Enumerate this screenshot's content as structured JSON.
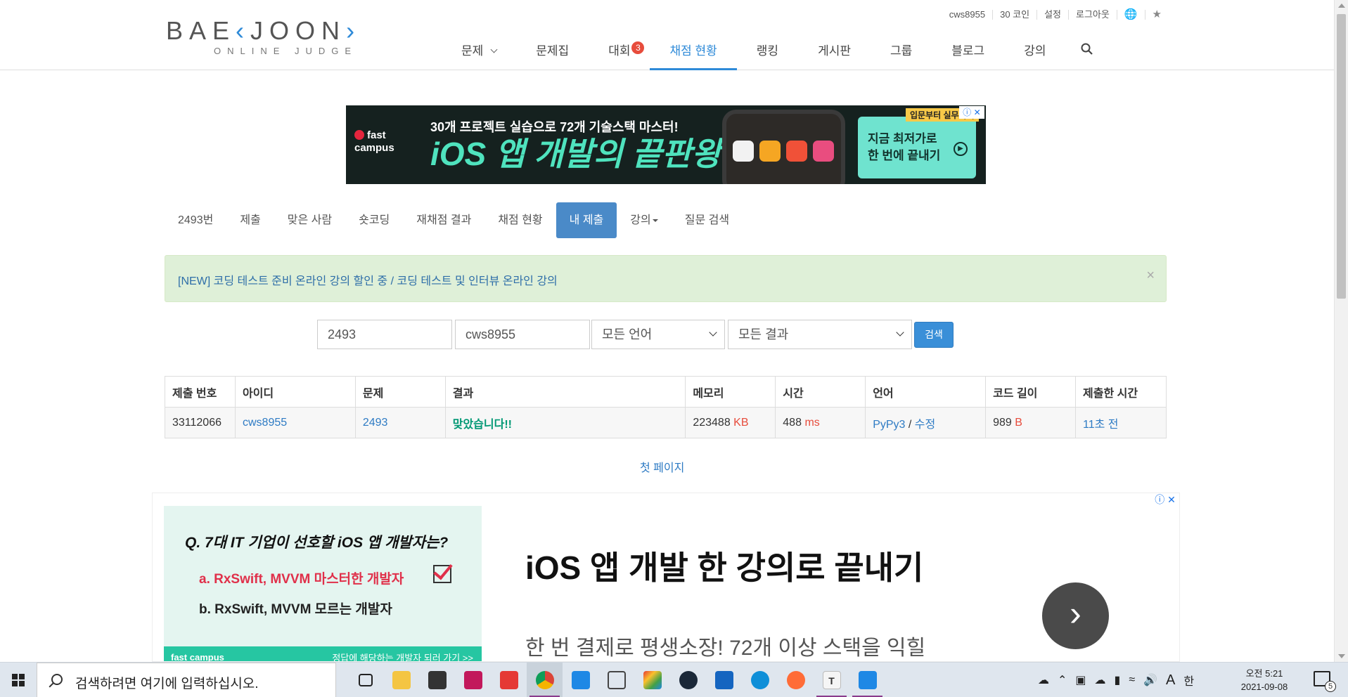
{
  "header": {
    "logo": {
      "prefix": "BAE",
      "k": "‹",
      "mid": "JOON",
      "suffix": "›",
      "sub": "ONLINE JUDGE"
    },
    "user_menu": [
      "cws8955",
      "30 코인",
      "설정",
      "로그아웃"
    ],
    "nav": [
      {
        "label": "문제"
      },
      {
        "label": "문제집"
      },
      {
        "label": "대회",
        "badge": "3"
      },
      {
        "label": "채점 현황",
        "active": true
      },
      {
        "label": "랭킹"
      },
      {
        "label": "게시판"
      },
      {
        "label": "그룹"
      },
      {
        "label": "블로그"
      },
      {
        "label": "강의"
      }
    ]
  },
  "ad_top": {
    "brand": "fast campus",
    "line1": "30개 프로젝트 실습으로 72개 기술스택 마스터!",
    "line2": "iOS 앱 개발의 끝판왕",
    "cta1": "지금 최저가로",
    "cta2": "한 번에 끝내기",
    "tag": "입문부터 실무까지"
  },
  "subnav": [
    {
      "label": "2493번"
    },
    {
      "label": "제출"
    },
    {
      "label": "맞은 사람"
    },
    {
      "label": "숏코딩"
    },
    {
      "label": "재채점 결과"
    },
    {
      "label": "채점 현황"
    },
    {
      "label": "내 제출",
      "active": true
    },
    {
      "label": "강의"
    },
    {
      "label": "질문 검색"
    }
  ],
  "alert": {
    "text": "[NEW] 코딩 테스트 준비 온라인 강의 할인 중 / 코딩 테스트 및 인터뷰 온라인 강의",
    "close": "×"
  },
  "search": {
    "problem_id": "2493",
    "user_id": "cws8955",
    "language": "모든 언어",
    "result": "모든 결과",
    "button": "검색"
  },
  "table": {
    "headers": [
      "제출 번호",
      "아이디",
      "문제",
      "결과",
      "메모리",
      "시간",
      "언어",
      "코드 길이",
      "제출한 시간"
    ],
    "row": {
      "submission_id": "33112066",
      "user": "cws8955",
      "problem": "2493",
      "result": "맞았습니다!!",
      "memory": "223488",
      "memory_unit": "KB",
      "time": "488",
      "time_unit": "ms",
      "language": "PyPy3",
      "lang_sep": " / ",
      "edit": "수정",
      "code_length": "989",
      "code_unit": "B",
      "submitted": "11초 전"
    }
  },
  "pagination": {
    "first_page": "첫 페이지"
  },
  "ad_bottom": {
    "question": "Q. 7대 IT 기업이 선호할 iOS 앱 개발자는?",
    "option_a": "a. RxSwift, MVVM 마스터한 개발자",
    "option_b": "b. RxSwift, MVVM 모르는 개발자",
    "strip_brand": "fast campus",
    "strip_text": "정답에 해당하는 개발자 되러 가기 >>",
    "headline": "iOS 앱 개발 한 강의로 끝내기",
    "subline": "한 번 결제로 평생소장! 72개 이상 스택을 익힐"
  },
  "taskbar": {
    "search_placeholder": "검색하려면 여기에 입력하십시오.",
    "tray_lang": "A",
    "tray_ime": "한",
    "clock_time": "오전 5:21",
    "clock_date": "2021-09-08",
    "notif_count": "5"
  },
  "colors": {
    "accent": "#2e8ad8",
    "accepted": "#009874",
    "unit": "#e74c3c",
    "alert_bg": "#dff0d8"
  }
}
